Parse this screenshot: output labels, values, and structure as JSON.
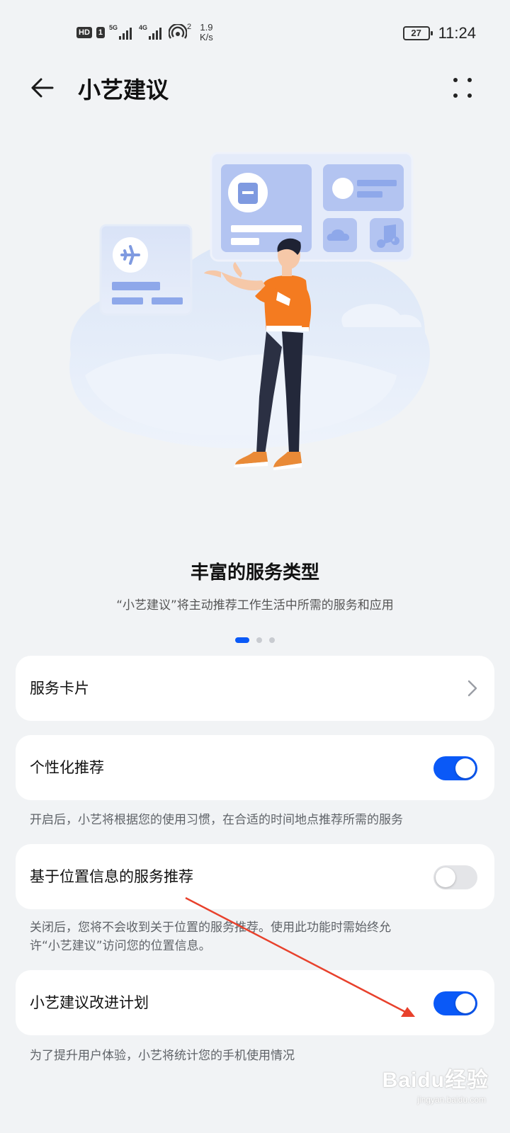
{
  "status_bar": {
    "badges": [
      "HD",
      "1"
    ],
    "sim1_network": "5G",
    "sim2_network": "4G",
    "hotspot_count": "2",
    "speed_value": "1.9",
    "speed_unit": "K/s",
    "battery": "27",
    "time": "11:24"
  },
  "app_bar": {
    "title": "小艺建议",
    "back_icon": "arrow-left-icon",
    "more_icon": "more-dots-icon"
  },
  "carousel": {
    "title": "丰富的服务类型",
    "description": "“小艺建议”将主动推荐工作生活中所需的服务和应用",
    "page_count": 3,
    "active_page": 1
  },
  "settings": {
    "service_cards": {
      "label": "服务卡片",
      "icon": "chevron-right-icon"
    },
    "personalized": {
      "label": "个性化推荐",
      "enabled": true,
      "note": "开启后，小艺将根据您的使用习惯，在合适的时间地点推荐所需的服务"
    },
    "location": {
      "label": "基于位置信息的服务推荐",
      "enabled": false,
      "note_line1": "关闭后，您将不会收到关于位置的服务推荐。使用此功能时需始终允",
      "note_line2": "许“小艺建议”访问您的位置信息。"
    },
    "improvement": {
      "label": "小艺建议改进计划",
      "enabled": true,
      "note": "为了提升用户体验，小艺将统计您的手机使用情况"
    }
  },
  "colors": {
    "accent": "#0a59f7",
    "background": "#f1f3f5",
    "annotation_arrow": "#e8412c",
    "shirt": "#f47b20"
  },
  "watermark": {
    "text": "Baidu经验",
    "sub": "jingyan.baidu.com"
  }
}
